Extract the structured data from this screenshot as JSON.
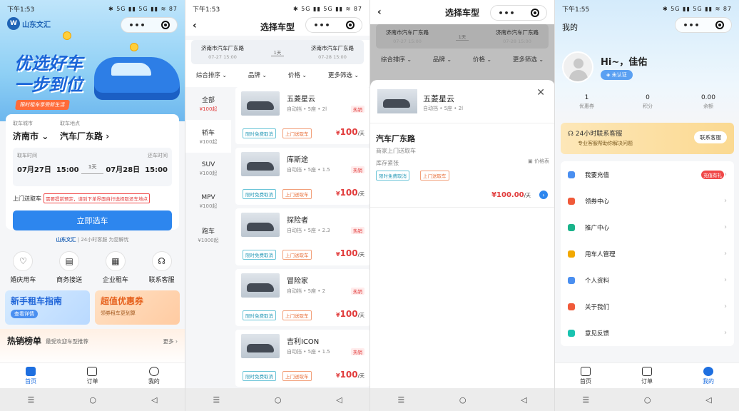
{
  "s1": {
    "status": {
      "time": "下午1:53",
      "signal": "✱ 5G ▮▮ 5G ▮▮ ≋ 87"
    },
    "logo": {
      "short": "W",
      "name": "山东文汇"
    },
    "hero": {
      "line1": "优选好车",
      "line2": "一步到位",
      "tag": "限时租车享受新生活"
    },
    "pickup_city_label": "取车城市",
    "pickup_loc_label": "取车地点",
    "city": "济南市",
    "location": "汽车厂东路",
    "pickup_time_label": "取车时间",
    "return_time_label": "还车时间",
    "pickup_date": "07月27日",
    "pickup_clock": "15:00",
    "duration": "1天",
    "return_date": "07月28日",
    "return_clock": "15:00",
    "delivery_label": "上门送取车",
    "delivery_note": "需要提前预定，请到下单界面自行选择取还车地点",
    "cta": "立即选车",
    "brand_logo": "山东文汇",
    "brand_slogan": "24小时客服 为您解忧",
    "quick": [
      {
        "label": "婚庆用车",
        "icon": "heart-car-icon"
      },
      {
        "label": "商务接送",
        "icon": "briefcase-icon"
      },
      {
        "label": "企业租车",
        "icon": "building-icon"
      },
      {
        "label": "联系客服",
        "icon": "headset-icon"
      }
    ],
    "promo1": {
      "title": "新手租车指南",
      "sub": "查看详情"
    },
    "promo2": {
      "title": "超值优惠券",
      "sub": "领券租车更划算"
    },
    "hot": {
      "title": "热销榜单",
      "sub": "最受欢迎车型推荐",
      "more": "更多 ›"
    },
    "tabs": [
      {
        "label": "首页",
        "icon": "home-icon"
      },
      {
        "label": "订单",
        "icon": "order-icon"
      },
      {
        "label": "我的",
        "icon": "user-icon"
      }
    ]
  },
  "s2": {
    "status": {
      "time": "下午1:53",
      "signal": "✱ 5G ▮▮ 5G ▮▮ ≋ 87"
    },
    "title": "选择车型",
    "from": "济南市汽车厂东路",
    "from_time": "07-27 15:00",
    "to": "济南市汽车厂东路",
    "to_time": "07-28 15:00",
    "days": "1天",
    "filters": [
      "综合排序",
      "品牌",
      "价格",
      "更多筛选"
    ],
    "categories": [
      {
        "name": "全部",
        "price": "¥100起"
      },
      {
        "name": "轿车",
        "price": "¥100起"
      },
      {
        "name": "SUV",
        "price": "¥100起"
      },
      {
        "name": "MPV",
        "price": "¥100起"
      },
      {
        "name": "跑车",
        "price": "¥1000起"
      }
    ],
    "cars": [
      {
        "name": "五菱星云",
        "spec": "自动挡 • 5座 • 2l",
        "hot": "热销",
        "tag1": "限时免费取消",
        "tag2": "上门送取车",
        "price": "100",
        "cur": "¥",
        "unit": "/天"
      },
      {
        "name": "库斯途",
        "spec": "自动挡 • 5座 • 1.5",
        "hot": "热销",
        "tag1": "限时免费取消",
        "tag2": "上门送取车",
        "price": "100",
        "cur": "¥",
        "unit": "/天"
      },
      {
        "name": "探险者",
        "spec": "自动挡 • 5座 • 2.3",
        "hot": "热销",
        "tag1": "限时免费取消",
        "tag2": "上门送取车",
        "price": "100",
        "cur": "¥",
        "unit": "/天"
      },
      {
        "name": "冒险家",
        "spec": "自动挡 • 5座 • 2",
        "hot": "热销",
        "tag1": "限时免费取消",
        "tag2": "上门送取车",
        "price": "100",
        "cur": "¥",
        "unit": "/天"
      },
      {
        "name": "吉利ICON",
        "spec": "自动挡 • 5座 • 1.5",
        "hot": "热销",
        "tag1": "限时免费取消",
        "tag2": "上门送取车",
        "price": "100",
        "cur": "¥",
        "unit": "/天"
      }
    ]
  },
  "s3": {
    "title": "选择车型",
    "from": "济南市汽车厂东路",
    "from_time": "07-27 15:00",
    "to": "济南市汽车厂东路",
    "to_time": "07-28 15:00",
    "days": "1天",
    "filters": [
      "综合排序",
      "品牌",
      "价格",
      "更多筛选"
    ],
    "car_name": "五菱星云",
    "car_spec": "自动挡 • 5座 • 2l",
    "store": "汽车厂东路",
    "store_sub": "商家上门送取车",
    "stock": "库存紧张",
    "price_table": "价格表",
    "tag1": "限时免费取消",
    "tag2": "上门送取车",
    "price": "¥100.00",
    "unit": "/天"
  },
  "s4": {
    "status": {
      "time": "下午1:55",
      "signal": "✱ 5G ▮▮ 5G ▮▮ ≋ 87"
    },
    "title": "我的",
    "greeting": "Hi~，佳佑",
    "verify": "未认证",
    "stats": [
      {
        "value": "1",
        "label": "优惠券"
      },
      {
        "value": "0",
        "label": "积分"
      },
      {
        "value": "0.00",
        "label": "余额"
      }
    ],
    "service": {
      "title": "24小时联系客服",
      "sub": "专业客服帮助你解决问题",
      "btn": "联系客服"
    },
    "menu": [
      {
        "label": "我要充值",
        "badge": "充值有礼",
        "color": "#4a8ff0"
      },
      {
        "label": "领券中心",
        "badge": "",
        "color": "#f05a3a"
      },
      {
        "label": "推广中心",
        "badge": "",
        "color": "#19b38a"
      },
      {
        "label": "用车人管理",
        "badge": "",
        "color": "#f2a800"
      },
      {
        "label": "个人资料",
        "badge": "",
        "color": "#4a8ff0"
      },
      {
        "label": "关于我们",
        "badge": "",
        "color": "#f05a3a"
      },
      {
        "label": "意见反馈",
        "badge": "",
        "color": "#19c3b0"
      }
    ]
  },
  "tabs": [
    {
      "label": "首页"
    },
    {
      "label": "订单"
    },
    {
      "label": "我的"
    }
  ],
  "sysnav": {
    "menu": "☰",
    "home": "○",
    "back": "◁"
  }
}
